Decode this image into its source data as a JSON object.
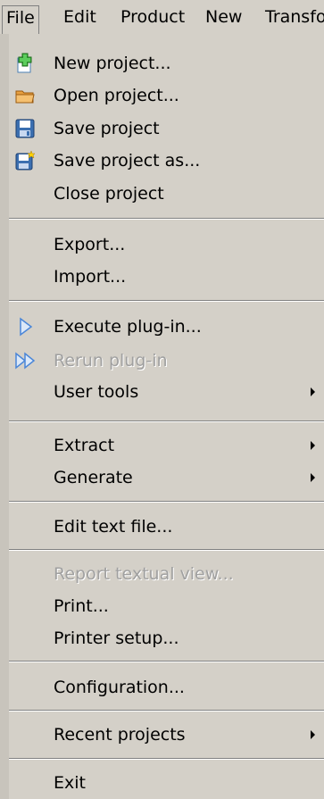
{
  "menubar": {
    "items": [
      {
        "label": "File"
      },
      {
        "label": "Edit"
      },
      {
        "label": "Product"
      },
      {
        "label": "New"
      },
      {
        "label": "Transfo"
      }
    ]
  },
  "menu": {
    "items": [
      {
        "label": "New project...",
        "icon": "new-project-icon"
      },
      {
        "label": "Open project...",
        "icon": "folder-icon"
      },
      {
        "label": "Save project",
        "icon": "save-icon"
      },
      {
        "label": "Save project as...",
        "icon": "save-as-icon"
      },
      {
        "label": "Close project"
      },
      {
        "label": "Export..."
      },
      {
        "label": "Import..."
      },
      {
        "label": "Execute plug-in...",
        "icon": "play-icon"
      },
      {
        "label": "Rerun plug-in",
        "icon": "fast-forward-icon",
        "disabled": true
      },
      {
        "label": "User tools",
        "submenu": true
      },
      {
        "label": "Extract",
        "submenu": true
      },
      {
        "label": "Generate",
        "submenu": true
      },
      {
        "label": "Edit text file..."
      },
      {
        "label": "Report textual view...",
        "disabled": true
      },
      {
        "label": "Print..."
      },
      {
        "label": "Printer setup..."
      },
      {
        "label": "Configuration..."
      },
      {
        "label": "Recent projects",
        "submenu": true
      },
      {
        "label": "Exit"
      }
    ]
  }
}
